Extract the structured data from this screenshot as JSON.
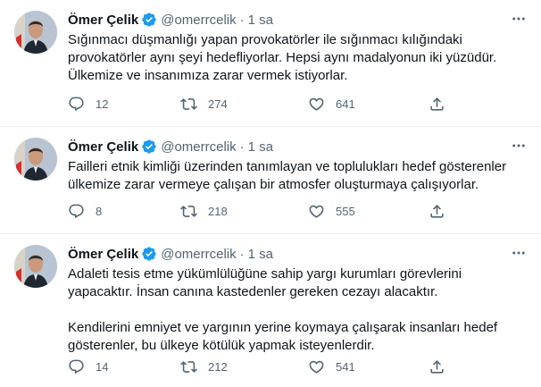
{
  "colors": {
    "text": "#0f1419",
    "muted": "#536471",
    "verified": "#1d9bf0",
    "divider": "#eff3f4"
  },
  "tweets": [
    {
      "author": {
        "name": "Ömer Çelik",
        "handle": "@omerrcelik",
        "verified": true
      },
      "separator": "·",
      "time": "1 sa",
      "text": "Sığınmacı düşmanlığı yapan provokatörler ile sığınmacı kılığındaki\nprovokatörler aynı şeyi hedefliyorlar. Hepsi aynı madalyonun iki yüzüdür.\nÜlkemize ve insanımıza zarar vermek istiyorlar.",
      "replies": "12",
      "retweets": "274",
      "likes": "641"
    },
    {
      "author": {
        "name": "Ömer Çelik",
        "handle": "@omerrcelik",
        "verified": true
      },
      "separator": "·",
      "time": "1 sa",
      "text": "Failleri etnik kimliği üzerinden tanımlayan ve toplulukları hedef gösterenler\nülkemize zarar vermeye çalışan bir atmosfer oluşturmaya çalışıyorlar.",
      "replies": "8",
      "retweets": "218",
      "likes": "555"
    },
    {
      "author": {
        "name": "Ömer Çelik",
        "handle": "@omerrcelik",
        "verified": true
      },
      "separator": "·",
      "time": "1 sa",
      "text": "Adaleti tesis etme yükümlülüğüne sahip yargı kurumları görevlerini\nyapacaktır. İnsan canına kastedenler gereken cezayı alacaktır.\n\nKendilerini emniyet ve yargının yerine koymaya çalışarak insanları hedef\ngösterenler, bu ülkeye kötülük yapmak isteyenlerdir.",
      "replies": "14",
      "retweets": "212",
      "likes": "541"
    }
  ]
}
